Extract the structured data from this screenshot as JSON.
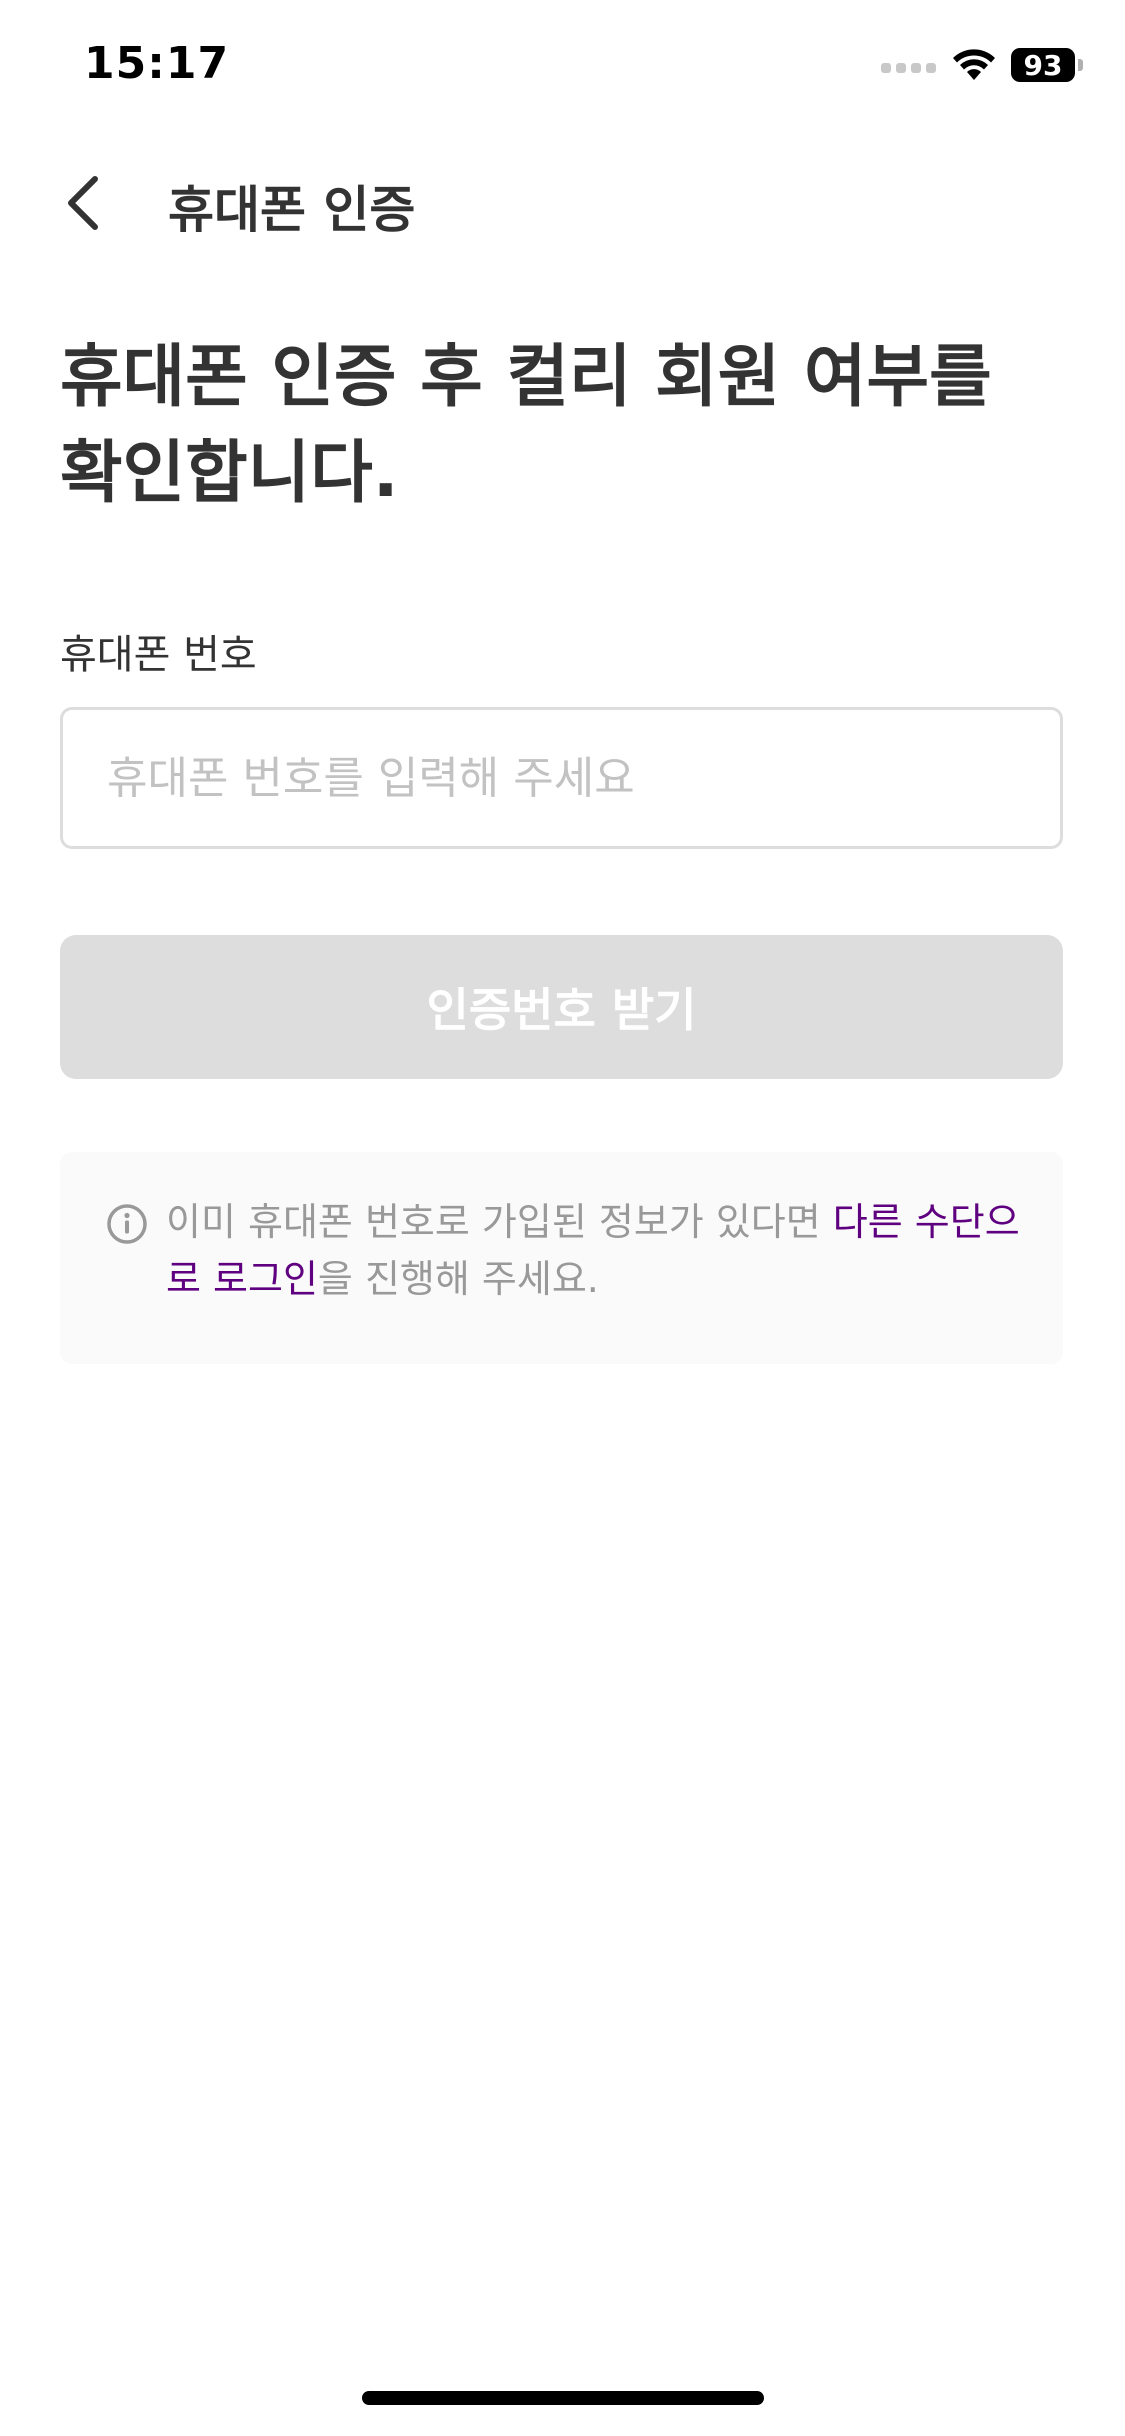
{
  "status_bar": {
    "time": "15:17",
    "battery_level": "93",
    "icons": [
      "signal-icon",
      "wifi-icon",
      "battery-icon"
    ]
  },
  "nav": {
    "title": "휴대폰 인증",
    "back_icon": "chevron-left-icon"
  },
  "headline": "휴대폰 인증 후 컬리 회원 여부를 확인합니다.",
  "form": {
    "phone_label": "휴대폰 번호",
    "phone_value": "",
    "phone_placeholder": "휴대폰 번호를 입력해 주세요",
    "submit_label": "인증번호 받기"
  },
  "notice": {
    "icon": "info-icon",
    "text_before": "이미 휴대폰 번호로 가입된 정보가 있다면 ",
    "link_text": "다른 수단으로 로그인",
    "text_after": "을 진행해 주세요."
  },
  "colors": {
    "brand": "#5f0080",
    "text_primary": "#333333",
    "text_secondary": "#999999",
    "disabled_button": "#dddddd",
    "input_border": "#dddddd",
    "notice_bg": "#fafafa"
  }
}
